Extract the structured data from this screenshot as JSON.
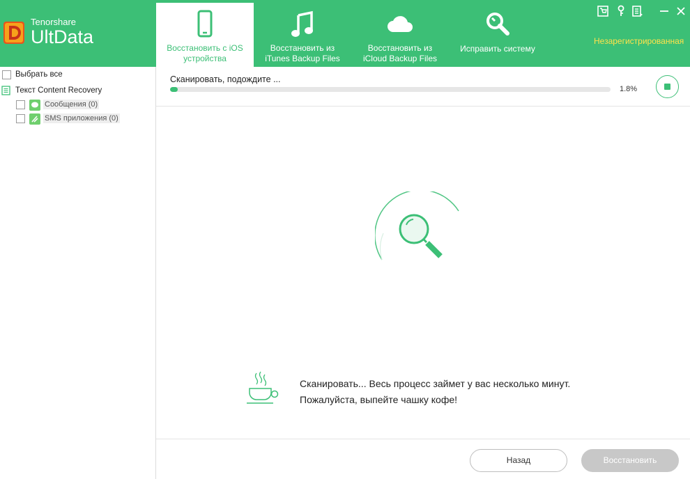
{
  "app": {
    "brand_small": "Tenorshare",
    "brand_name": "UltData",
    "unregistered": "Незарегистрированная"
  },
  "nav": {
    "tabs": [
      {
        "label": "Восстановить с iOS\nустройства",
        "icon": "phone-icon",
        "active": true
      },
      {
        "label": "Восстановить из\niTunes Backup Files",
        "icon": "music-note-icon",
        "active": false
      },
      {
        "label": "Восстановить из\niCloud Backup Files",
        "icon": "cloud-icon",
        "active": false
      },
      {
        "label": "Исправить систему",
        "icon": "wrench-icon",
        "active": false
      }
    ]
  },
  "sidebar": {
    "select_all": "Выбрать все",
    "category": "Текст Content Recovery",
    "items": [
      {
        "label": "Сообщения (0)",
        "icon": "messages-icon"
      },
      {
        "label": "SMS приложения (0)",
        "icon": "sms-apps-icon"
      }
    ]
  },
  "progress": {
    "label": "Сканировать, подождите ...",
    "percent_text": "1.8%",
    "percent": 1.8
  },
  "main": {
    "message_line1": "Сканировать... Весь процесс займет у вас несколько минут.",
    "message_line2": "Пожалуйста, выпейте чашку кофе!"
  },
  "footer": {
    "back_label": "Назад",
    "recover_label": "Восстановить"
  },
  "colors": {
    "accent": "#3cbf76",
    "unregistered": "#ffe24a",
    "disabled_button": "#c8c8c8"
  }
}
